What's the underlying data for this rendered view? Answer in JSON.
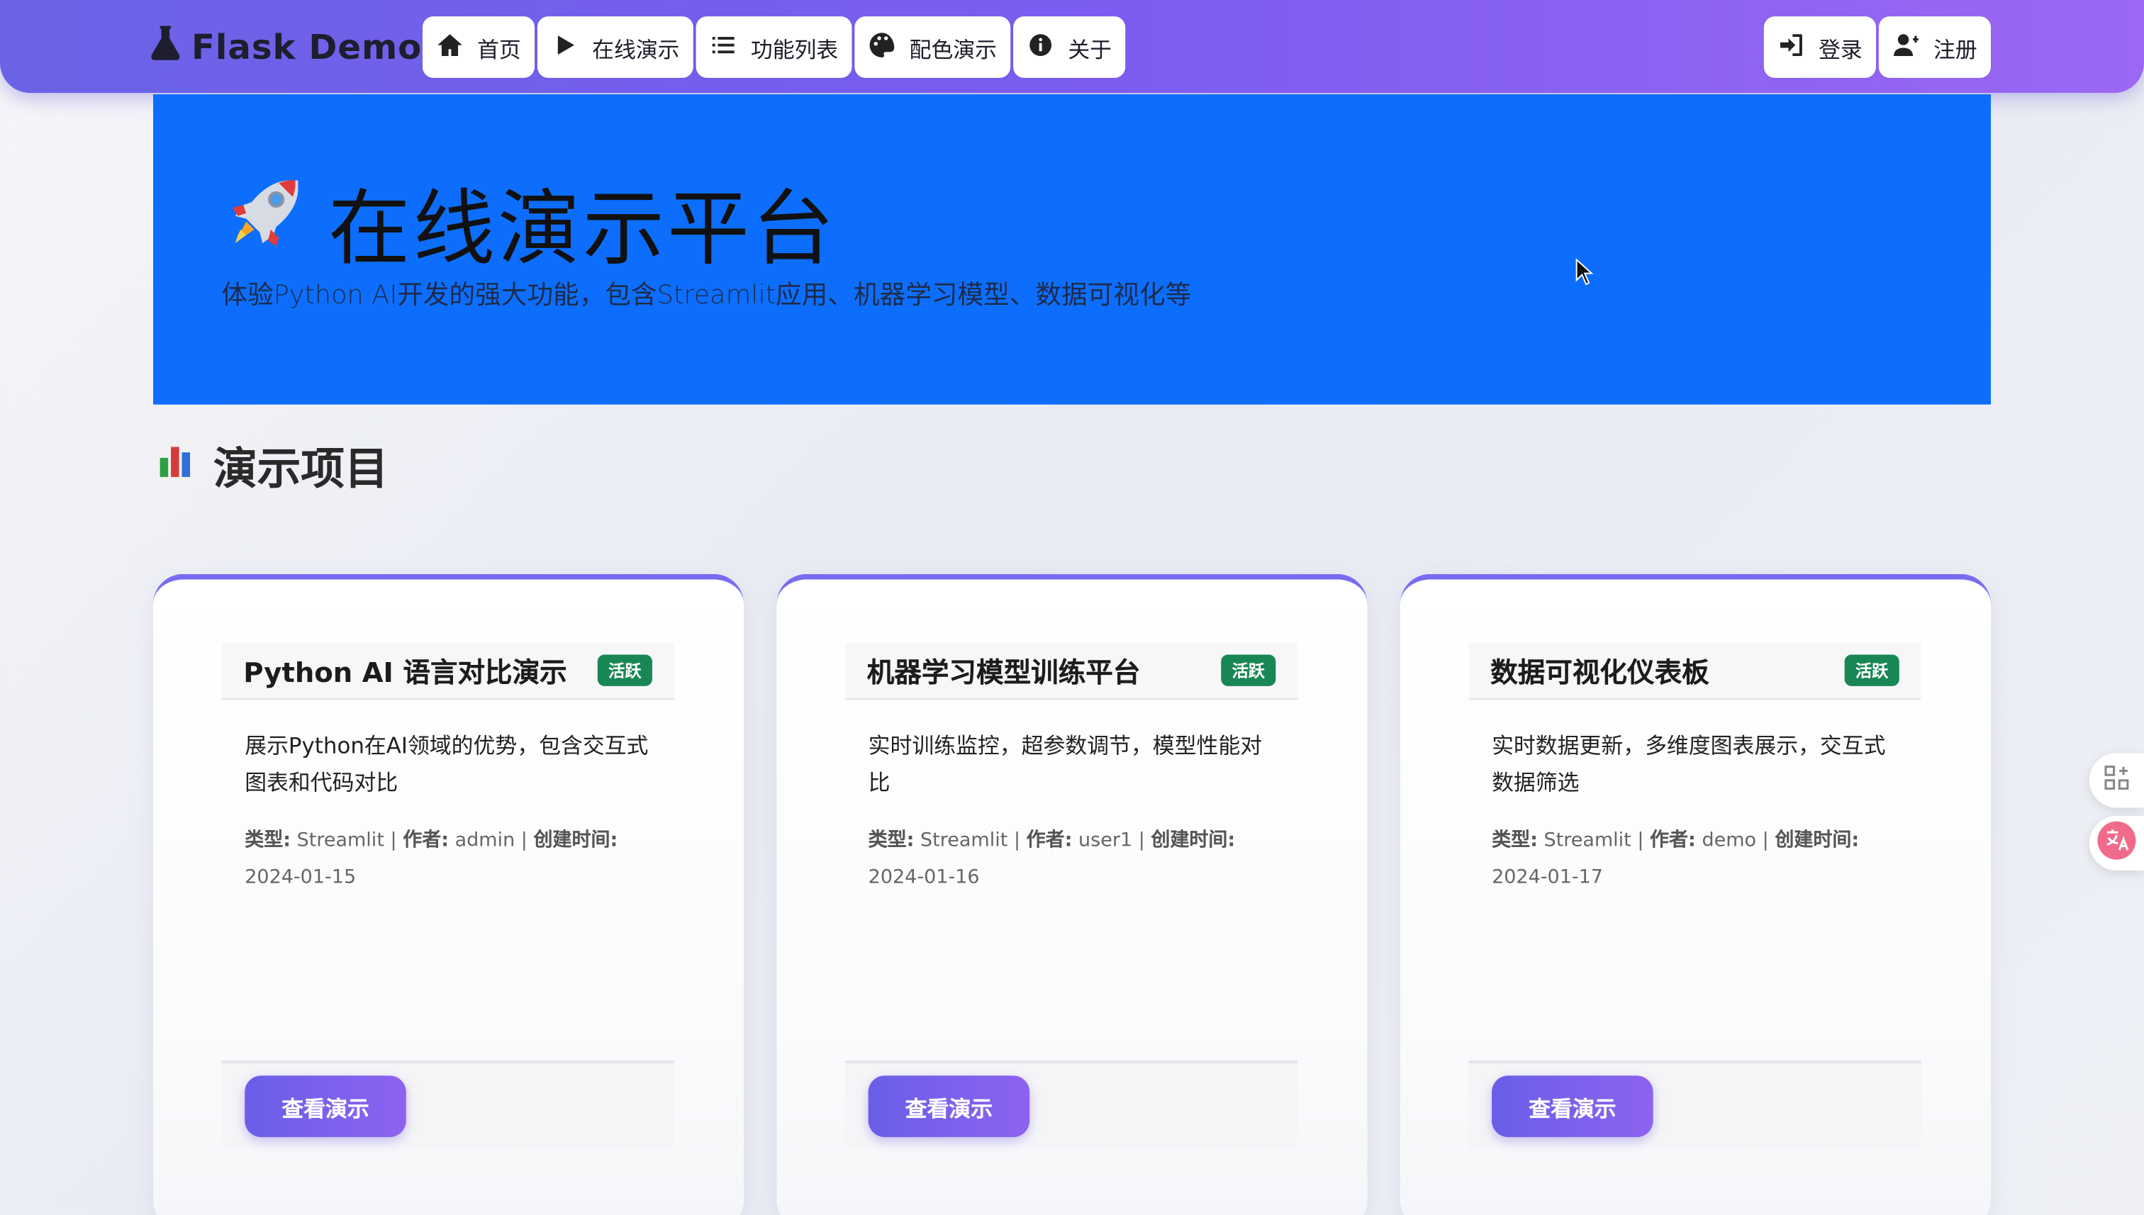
{
  "brand": {
    "name": "Flask Demo",
    "icon": "flask-icon"
  },
  "nav": {
    "left": [
      {
        "label": "首页",
        "icon": "home-icon"
      },
      {
        "label": "在线演示",
        "icon": "play-icon"
      },
      {
        "label": "功能列表",
        "icon": "list-icon"
      },
      {
        "label": "配色演示",
        "icon": "palette-icon"
      },
      {
        "label": "关于",
        "icon": "info-icon"
      }
    ],
    "right": [
      {
        "label": "登录",
        "icon": "sign-in-icon"
      },
      {
        "label": "注册",
        "icon": "user-plus-icon"
      }
    ]
  },
  "hero": {
    "title": "在线演示平台",
    "subtitle": "体验Python AI开发的强大功能，包含Streamlit应用、机器学习模型、数据可视化等",
    "background": "#0d6efd"
  },
  "section": {
    "title": "演示项目"
  },
  "cards": [
    {
      "title": "Python AI 语言对比演示",
      "badge": "活跃",
      "description": "展示Python在AI领域的优势，包含交互式图表和代码对比",
      "type_label": "类型:",
      "type": "Streamlit",
      "author_label": "作者:",
      "author": "admin",
      "created_label": "创建时间:",
      "created": "2024-01-15",
      "button": "查看演示"
    },
    {
      "title": "机器学习模型训练平台",
      "badge": "活跃",
      "description": "实时训练监控，超参数调节，模型性能对比",
      "type_label": "类型:",
      "type": "Streamlit",
      "author_label": "作者:",
      "author": "user1",
      "created_label": "创建时间:",
      "created": "2024-01-16",
      "button": "查看演示"
    },
    {
      "title": "数据可视化仪表板",
      "badge": "活跃",
      "description": "实时数据更新，多维度图表展示，交互式数据筛选",
      "type_label": "类型:",
      "type": "Streamlit",
      "author_label": "作者:",
      "author": "demo",
      "created_label": "创建时间:",
      "created": "2024-01-17",
      "button": "查看演示"
    }
  ],
  "colors": {
    "accent": "#7b5cf0",
    "badge": "#198754",
    "hero": "#0d6efd"
  }
}
